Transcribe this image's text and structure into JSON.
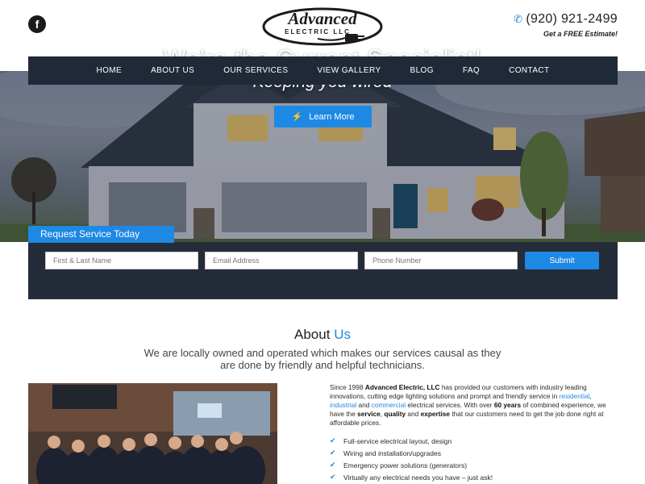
{
  "header": {
    "facebook_glyph": "f",
    "logo_text_main": "Advanced",
    "logo_text_sub": "ELECTRIC LLC",
    "phone": "(920) 921-2499",
    "estimate": "Get a FREE Estimate!"
  },
  "nav": {
    "items": [
      "HOME",
      "ABOUT US",
      "OUR SERVICES",
      "VIEW GALLERY",
      "BLOG",
      "FAQ",
      "CONTACT"
    ]
  },
  "hero": {
    "title": "We're the Current Specialist!",
    "subtitle": "Keeping you wired",
    "button_label": "Learn More"
  },
  "request_form": {
    "tab_label": "Request Service Today",
    "name_placeholder": "First & Last Name",
    "email_placeholder": "Email Address",
    "phone_placeholder": "Phone Number",
    "submit_label": "Submit"
  },
  "about": {
    "title_prefix": "About",
    "title_accent": "Us",
    "subtitle": "We are locally owned and operated which makes our services causal as they are done by friendly and helpful technicians.",
    "para_1": "Since 1998 ",
    "para_company": "Advanced Electric, LLC",
    "para_2": " has provided our customers with industry leading innovations, cutting edge lighting solutions and prompt and friendly service in ",
    "para_link_1": "residential",
    "para_3": ", ",
    "para_link_2": "industrial",
    "para_4": " and ",
    "para_link_3": "commercial",
    "para_5": " electrical services. With over ",
    "para_bold_1": "60 years",
    "para_6": " of combined experience, we have the ",
    "para_bold_2": "service",
    "para_7": ", ",
    "para_bold_3": "quality",
    "para_8": " and ",
    "para_bold_4": "expertise",
    "para_9": " that our customers need to get the job done right at affordable prices.",
    "checklist": [
      "Full-service electrical layout, design",
      "Wiring and installation/upgrades",
      "Emergency power solutions (generators)",
      "Virtually any electrical needs you have – just ask!"
    ]
  },
  "colors": {
    "accent": "#1e88e5",
    "nav_bg": "#1f2937",
    "form_bg": "#242c3a"
  }
}
